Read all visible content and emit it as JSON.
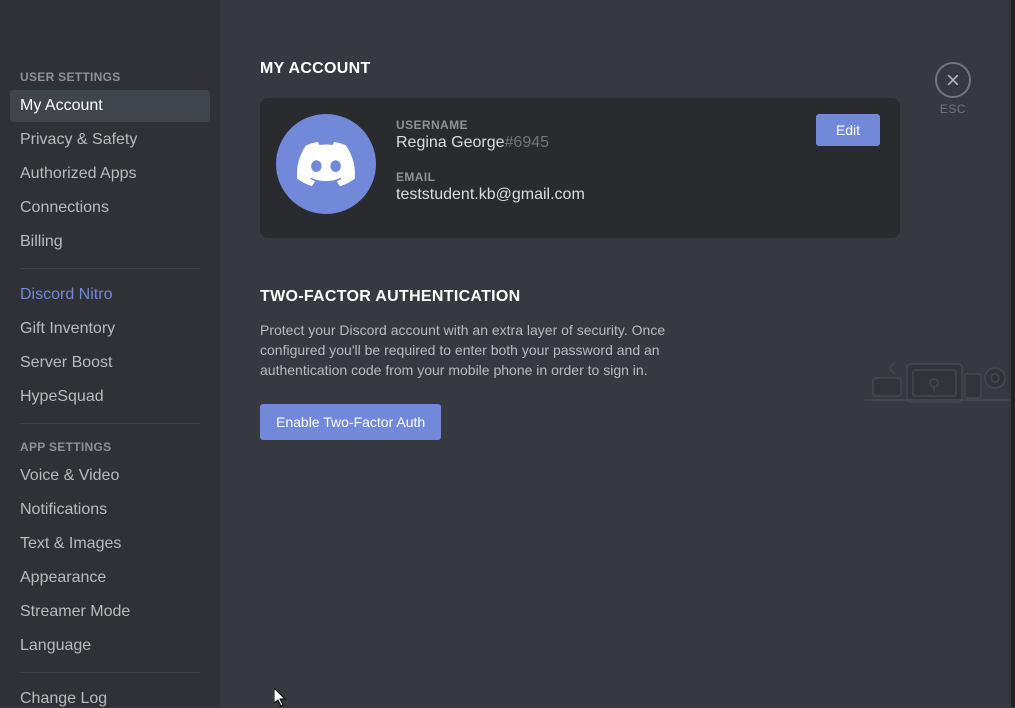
{
  "sidebar": {
    "user_settings_heading": "USER SETTINGS",
    "app_settings_heading": "APP SETTINGS",
    "items": [
      {
        "label": "My Account"
      },
      {
        "label": "Privacy & Safety"
      },
      {
        "label": "Authorized Apps"
      },
      {
        "label": "Connections"
      },
      {
        "label": "Billing"
      },
      {
        "label": "Discord Nitro"
      },
      {
        "label": "Gift Inventory"
      },
      {
        "label": "Server Boost"
      },
      {
        "label": "HypeSquad"
      },
      {
        "label": "Voice & Video"
      },
      {
        "label": "Notifications"
      },
      {
        "label": "Text & Images"
      },
      {
        "label": "Appearance"
      },
      {
        "label": "Streamer Mode"
      },
      {
        "label": "Language"
      },
      {
        "label": "Change Log"
      }
    ]
  },
  "main": {
    "page_title": "MY ACCOUNT",
    "account": {
      "username_label": "USERNAME",
      "username": "Regina George",
      "discriminator": "#6945",
      "email_label": "EMAIL",
      "email": "teststudent.kb@gmail.com",
      "edit_label": "Edit"
    },
    "twofa": {
      "title": "TWO-FACTOR AUTHENTICATION",
      "description": "Protect your Discord account with an extra layer of security. Once configured you'll be required to enter both your password and an authentication code from your mobile phone in order to sign in.",
      "enable_label": "Enable Two-Factor Auth"
    }
  },
  "close": {
    "label": "ESC"
  }
}
